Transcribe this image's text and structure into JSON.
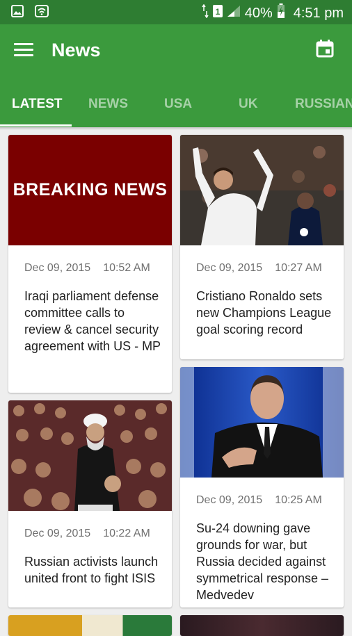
{
  "status_bar": {
    "battery": "40%",
    "time": "4:51 pm"
  },
  "app_bar": {
    "title": "News"
  },
  "tabs": [
    {
      "label": "LATEST"
    },
    {
      "label": "NEWS"
    },
    {
      "label": "USA"
    },
    {
      "label": "UK"
    },
    {
      "label": "RUSSIAN"
    }
  ],
  "breaking_banner": "BREAKING NEWS",
  "articles": [
    {
      "date": "Dec 09, 2015",
      "time": "10:52 AM",
      "headline": "Iraqi parliament defense committee calls to review & cancel security agreement with US - MP"
    },
    {
      "date": "Dec 09, 2015",
      "time": "10:27 AM",
      "headline": "Cristiano Ronaldo sets new Champions League goal scoring record"
    },
    {
      "date": "Dec 09, 2015",
      "time": "10:22 AM",
      "headline": "Russian activists launch united front to fight ISIS"
    },
    {
      "date": "Dec 09, 2015",
      "time": "10:25 AM",
      "headline": "Su-24 downing gave grounds for war, but Russia decided against symmetrical response – Medvedev"
    }
  ]
}
